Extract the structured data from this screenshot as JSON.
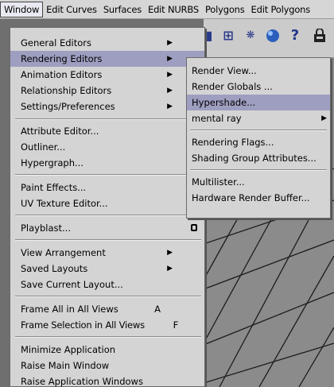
{
  "menubar": {
    "items": [
      "Window",
      "Edit Curves",
      "Surfaces",
      "Edit NURBS",
      "Polygons",
      "Edit Polygons"
    ]
  },
  "toolbar": {
    "icons": [
      "hand-icon",
      "grid-icon",
      "sparkle-icon",
      "sphere-icon",
      "help-icon",
      "lock-icon"
    ],
    "help_glyph": "?"
  },
  "window_menu": {
    "items": [
      {
        "label": "General Editors",
        "submenu": true
      },
      {
        "label": "Rendering Editors",
        "submenu": true,
        "highlighted": true
      },
      {
        "label": "Animation Editors",
        "submenu": true
      },
      {
        "label": "Relationship Editors",
        "submenu": true
      },
      {
        "label": "Settings/Preferences",
        "submenu": true
      },
      {
        "label": "Attribute Editor..."
      },
      {
        "label": "Outliner..."
      },
      {
        "label": "Hypergraph..."
      },
      {
        "label": "Paint Effects..."
      },
      {
        "label": "UV Texture Editor..."
      },
      {
        "label": "Playblast...",
        "option_box": true
      },
      {
        "label": "View Arrangement",
        "submenu": true
      },
      {
        "label": "Saved Layouts",
        "submenu": true
      },
      {
        "label": "Save Current Layout..."
      },
      {
        "label": "Frame All in All Views",
        "shortcut": "A"
      },
      {
        "label": "Frame Selection in All Views",
        "shortcut": "F"
      },
      {
        "label": "Minimize Application"
      },
      {
        "label": "Raise Main Window"
      },
      {
        "label": "Raise Application Windows"
      }
    ]
  },
  "rendering_submenu": {
    "items": [
      {
        "label": "Render View..."
      },
      {
        "label": "Render Globals ..."
      },
      {
        "label": "Hypershade...",
        "highlighted": true
      },
      {
        "label": "mental ray",
        "submenu": true
      },
      {
        "label": "Rendering Flags..."
      },
      {
        "label": "Shading Group Attributes..."
      },
      {
        "label": "Multilister..."
      },
      {
        "label": "Hardware Render Buffer..."
      }
    ]
  },
  "colors": {
    "menu_bg": "#d4d4d4",
    "highlight": "#9e9ec0",
    "viewport": "#8a8a8a"
  }
}
